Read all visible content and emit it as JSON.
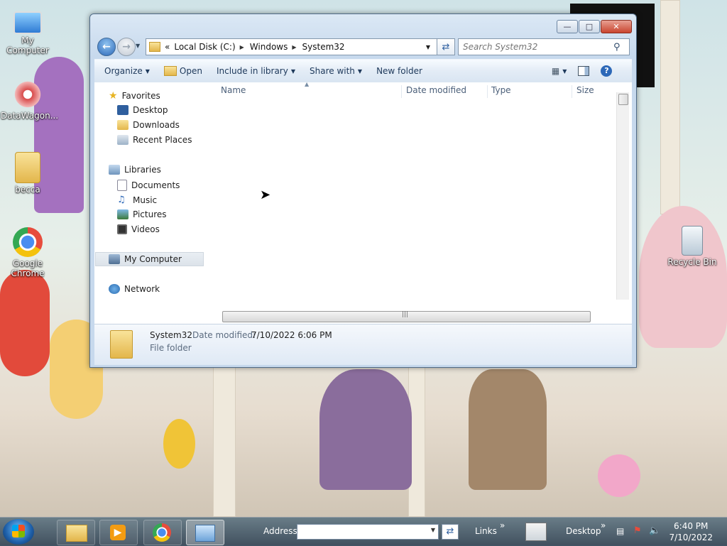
{
  "desktop": {
    "icons": [
      {
        "label": "My Computer"
      },
      {
        "label": "DataWagon..."
      },
      {
        "label": "becca"
      },
      {
        "label": "Google Chrome"
      },
      {
        "label": "Recycle Bin"
      }
    ]
  },
  "window": {
    "address": {
      "crumbs": [
        "Local Disk (C:)",
        "Windows",
        "System32"
      ],
      "overflow": "«"
    },
    "search_placeholder": "Search System32",
    "toolbar": {
      "organize": "Organize",
      "open": "Open",
      "include": "Include in library",
      "share": "Share with",
      "new_folder": "New folder"
    },
    "nav": {
      "favorites": "Favorites",
      "favorites_items": [
        "Desktop",
        "Downloads",
        "Recent Places"
      ],
      "libraries": "Libraries",
      "libraries_items": [
        "Documents",
        "Music",
        "Pictures",
        "Videos"
      ],
      "computer": "My Computer",
      "network": "Network"
    },
    "columns": [
      "Name",
      "Date modified",
      "Type",
      "Size"
    ],
    "details": {
      "name": "System32",
      "date_label": "Date modified:",
      "date_value": "7/10/2022 6:06 PM",
      "type": "File folder"
    }
  },
  "taskbar": {
    "address_label": "Address",
    "links_label": "Links",
    "desktop_label": "Desktop",
    "time": "6:40 PM",
    "date": "7/10/2022"
  },
  "colors": {
    "accent": "#2d68b8",
    "window_frame": "#c7d9ed",
    "close_button": "#c9452f"
  }
}
